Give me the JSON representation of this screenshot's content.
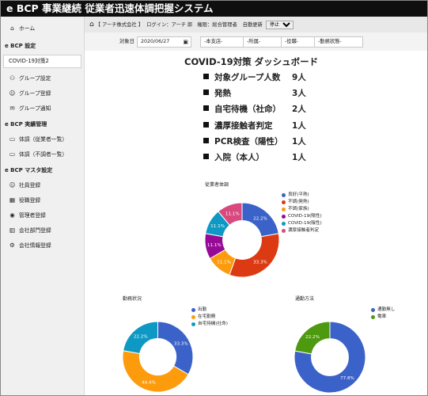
{
  "app": {
    "title": "e BCP 事業継続 従業者迅速体調把握システム"
  },
  "topbar": {
    "home_icon": "home-icon",
    "company": "【 アーチ株式会社 】",
    "login": "ログイン：アーチ 郎",
    "authority": "権限：総合管理者",
    "auto_update_label": "自動更新",
    "auto_update_value": "停止"
  },
  "filters": {
    "date_label": "対象日",
    "date_value": "2020/06/27",
    "headquarters": "-本支店-",
    "department": "-所属-",
    "position": "-役職-",
    "work_status": "-勤務状態-"
  },
  "sidebar": {
    "home": "ホーム",
    "sections": [
      {
        "title": "e BCP 設定",
        "items": [
          {
            "label": "COVID-19対策2",
            "icon": "",
            "active": true
          },
          {
            "label": "グループ設定",
            "icon": "group-icon"
          },
          {
            "label": "グループ登録",
            "icon": "user-add-icon"
          },
          {
            "label": "グループ通知",
            "icon": "mail-icon"
          }
        ]
      },
      {
        "title": "e BCP 実績管理",
        "items": [
          {
            "label": "体調（従業者一覧）",
            "icon": "monitor-icon"
          },
          {
            "label": "体調（不調者一覧）",
            "icon": "monitor-icon"
          }
        ]
      },
      {
        "title": "e BCP マスタ設定",
        "items": [
          {
            "label": "社員登録",
            "icon": "user-add-icon"
          },
          {
            "label": "役職登録",
            "icon": "grid-icon"
          },
          {
            "label": "管理者登録",
            "icon": "eye-icon"
          },
          {
            "label": "会社部門登録",
            "icon": "building-icon"
          },
          {
            "label": "会社情報登録",
            "icon": "gear-icon"
          }
        ]
      }
    ]
  },
  "dashboard": {
    "title": "COVID-19対策 ダッシュボード",
    "summary": [
      {
        "label": "対象グループ人数",
        "value": "9人"
      },
      {
        "label": "発熱",
        "value": "3人"
      },
      {
        "label": "自宅待機（社命）",
        "value": "2人"
      },
      {
        "label": "濃厚接触者判定",
        "value": "1人"
      },
      {
        "label": "PCR検査（陽性）",
        "value": "1人"
      },
      {
        "label": "入院（本人）",
        "value": "1人"
      }
    ]
  },
  "chart_data": [
    {
      "type": "pie",
      "title": "従業者体調",
      "categories": [
        "良好(平熱)",
        "不調(発熱)",
        "不調(家族)",
        "COVID-19(陽性)",
        "COVID-19(陰性)",
        "濃厚接触者判定"
      ],
      "values": [
        22.2,
        33.3,
        11.1,
        11.1,
        11.1,
        11.1
      ],
      "labels": [
        "22.2%",
        "33.3%",
        "11.1%",
        "11.1%",
        "11.1%",
        "11.1%"
      ],
      "colors": [
        "#3a62c8",
        "#dc3a12",
        "#fc9b0c",
        "#960a95",
        "#0e99c4",
        "#d84a7e"
      ],
      "legend": "right"
    },
    {
      "type": "pie",
      "title": "勤務状況",
      "categories": [
        "出勤",
        "在宅勤務",
        "自宅待機(社命)"
      ],
      "values": [
        33.3,
        44.4,
        22.2
      ],
      "labels": [
        "33.3%",
        "44.4%",
        "22.2%"
      ],
      "colors": [
        "#3a62c8",
        "#fc9b0c",
        "#0e99c4"
      ],
      "legend": "right"
    },
    {
      "type": "pie",
      "title": "通勤方法",
      "categories": [
        "通勤無し",
        "電車"
      ],
      "values": [
        77.8,
        22.2
      ],
      "labels": [
        "77.8%",
        "22.2%"
      ],
      "colors": [
        "#3a62c8",
        "#4d9a10"
      ],
      "legend": "right"
    }
  ]
}
